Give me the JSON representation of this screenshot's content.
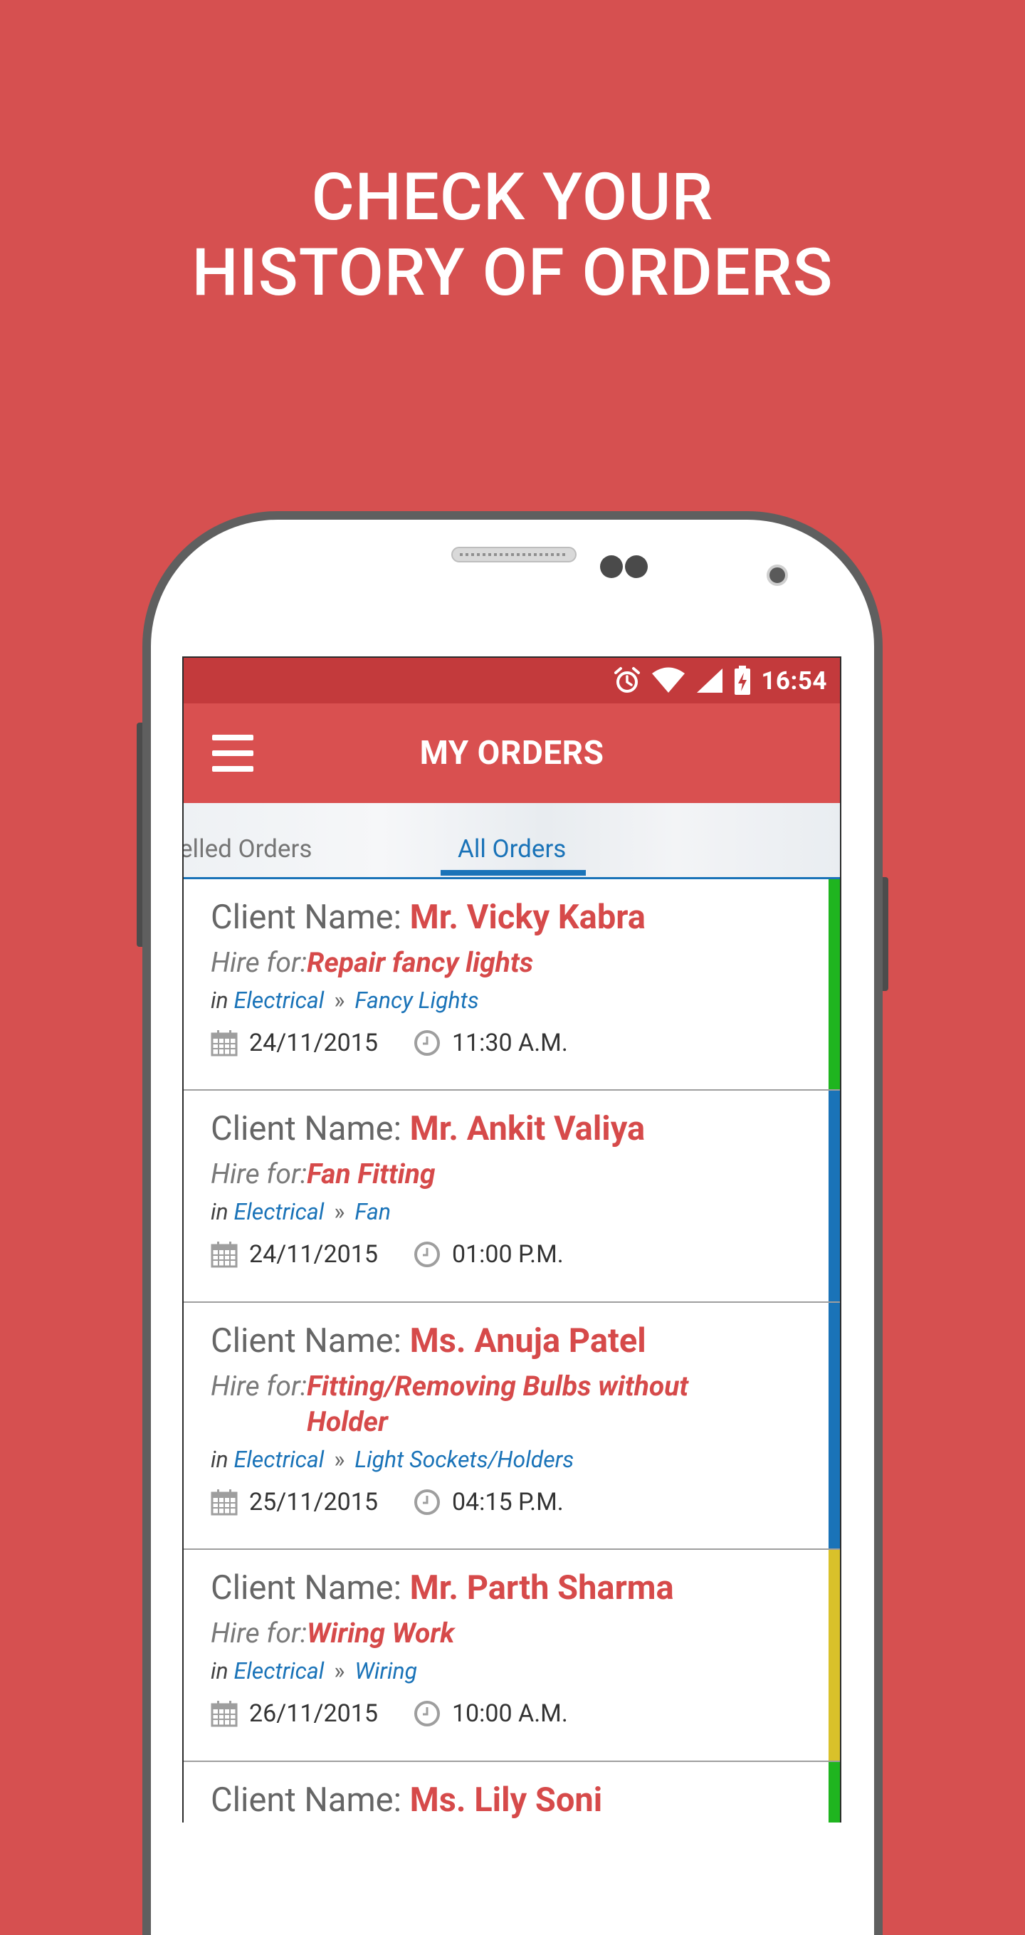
{
  "headline": {
    "line1": "CHECK YOUR",
    "line2": "HISTORY OF ORDERS"
  },
  "status_bar": {
    "time": "16:54",
    "icons": [
      "alarm-icon",
      "wifi-icon",
      "signal-icon",
      "battery-charging-icon"
    ]
  },
  "app_bar": {
    "title": "MY ORDERS",
    "menu_icon": "hamburger-menu-icon"
  },
  "tabs": [
    {
      "label": "elled Orders",
      "selected": false
    },
    {
      "label": "All Orders",
      "selected": true
    }
  ],
  "labels": {
    "client": "Client Name: ",
    "hire": "Hire for: ",
    "in": "in "
  },
  "orders": [
    {
      "client": "Mr. Vicky Kabra",
      "hire_line1": "Repair fancy lights",
      "hire_line2": "",
      "category": "Electrical",
      "subcategory": "Fancy Lights",
      "date": "24/11/2015",
      "time": "11:30 A.M.",
      "accent": "#1fb51f"
    },
    {
      "client": "Mr. Ankit Valiya",
      "hire_line1": "Fan Fitting",
      "hire_line2": "",
      "category": "Electrical",
      "subcategory": "Fan",
      "date": "24/11/2015",
      "time": "01:00 P.M.",
      "accent": "#1a73b8"
    },
    {
      "client": "Ms. Anuja Patel",
      "hire_line1": "Fitting/Removing Bulbs without",
      "hire_line2": "Holder",
      "category": "Electrical",
      "subcategory": "Light Sockets/Holders",
      "date": "25/11/2015",
      "time": "04:15 P.M.",
      "accent": "#1a73b8"
    },
    {
      "client": "Mr. Parth Sharma",
      "hire_line1": "Wiring Work",
      "hire_line2": "",
      "category": "Electrical",
      "subcategory": "Wiring",
      "date": "26/11/2015",
      "time": "10:00 A.M.",
      "accent": "#d9c12a"
    },
    {
      "client": "Ms. Lily Soni",
      "accent": "#1fb51f"
    }
  ],
  "colors": {
    "background": "#d65050",
    "status_bar": "#c33a3c",
    "app_bar": "#d95050",
    "accent_blue": "#1a73b8",
    "client_red": "#d64a4a"
  }
}
